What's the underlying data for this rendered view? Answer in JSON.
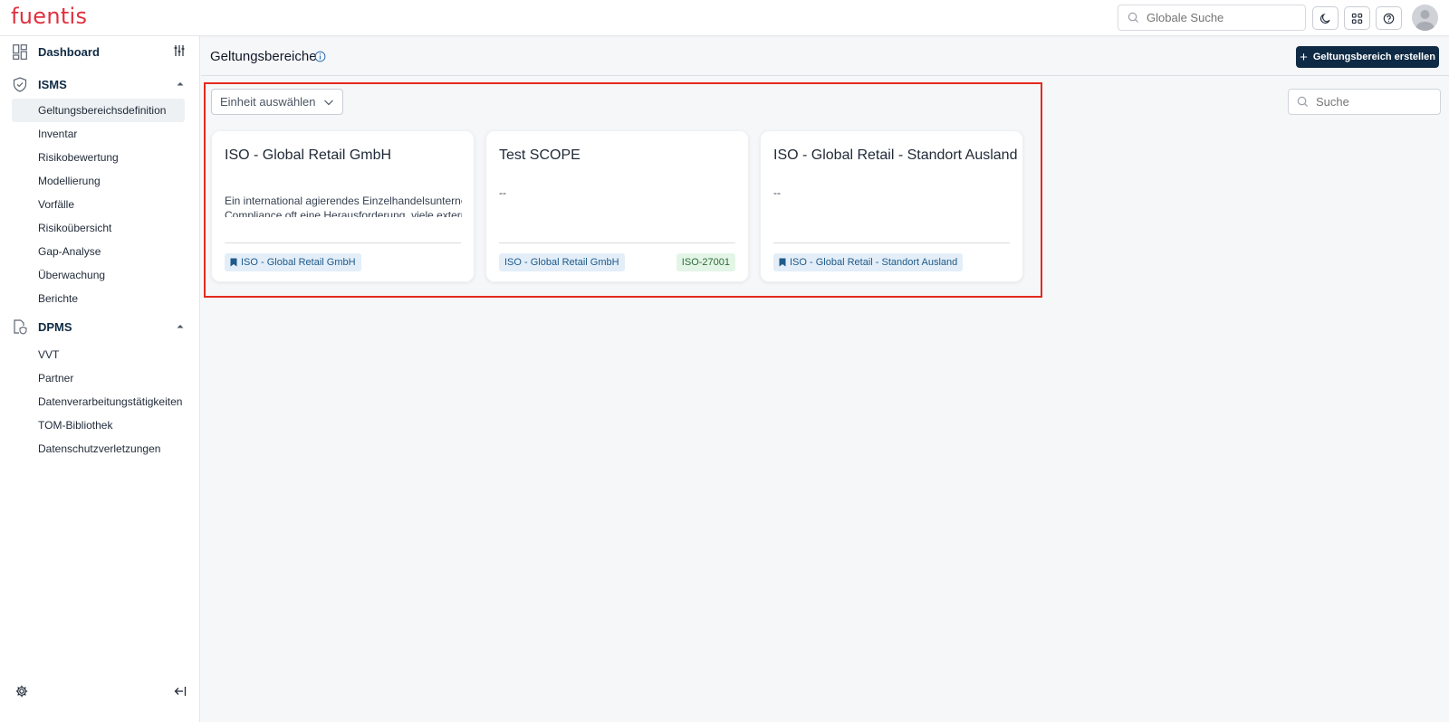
{
  "app": {
    "logo": "fuentis"
  },
  "topbar": {
    "search_placeholder": "Globale Suche",
    "icons": [
      "moon-icon",
      "apps-grid-icon",
      "help-icon",
      "user-avatar"
    ]
  },
  "sidebar": {
    "dashboard": {
      "label": "Dashboard"
    },
    "isms": {
      "label": "ISMS",
      "items": [
        {
          "label": "Geltungsbereichsdefinition",
          "active": true
        },
        {
          "label": "Inventar"
        },
        {
          "label": "Risikobewertung"
        },
        {
          "label": "Modellierung"
        },
        {
          "label": "Vorfälle"
        },
        {
          "label": "Risikoübersicht"
        },
        {
          "label": "Gap-Analyse"
        },
        {
          "label": "Überwachung"
        },
        {
          "label": "Berichte"
        }
      ]
    },
    "dpms": {
      "label": "DPMS",
      "items": [
        {
          "label": "VVT"
        },
        {
          "label": "Partner"
        },
        {
          "label": "Datenverarbeitungstätigkeiten"
        },
        {
          "label": "TOM-Bibliothek"
        },
        {
          "label": "Datenschutzverletzungen"
        }
      ]
    }
  },
  "page": {
    "title": "Geltungsbereiche",
    "create_button": "Geltungsbereich erstellen",
    "unit_select": "Einheit auswählen",
    "search_placeholder": "Suche"
  },
  "cards": [
    {
      "title": "ISO - Global Retail GmbH",
      "desc_line1": "Ein international agierendes Einzelhandelsunternehmen,",
      "desc_line2": "Compliance oft eine Herausforderung, viele externe",
      "tag": "ISO - Global Retail GmbH"
    },
    {
      "title": "Test SCOPE",
      "desc_line1": "--",
      "tag": "ISO - Global Retail GmbH",
      "tag2": "ISO-27001"
    },
    {
      "title": "ISO - Global Retail - Standort Ausland",
      "desc_line1": "--",
      "tag": "ISO - Global Retail - Standort Ausland"
    }
  ],
  "colors": {
    "brand": "#e0313f",
    "primary": "#0f2a44",
    "highlight": "#e32a1f"
  }
}
